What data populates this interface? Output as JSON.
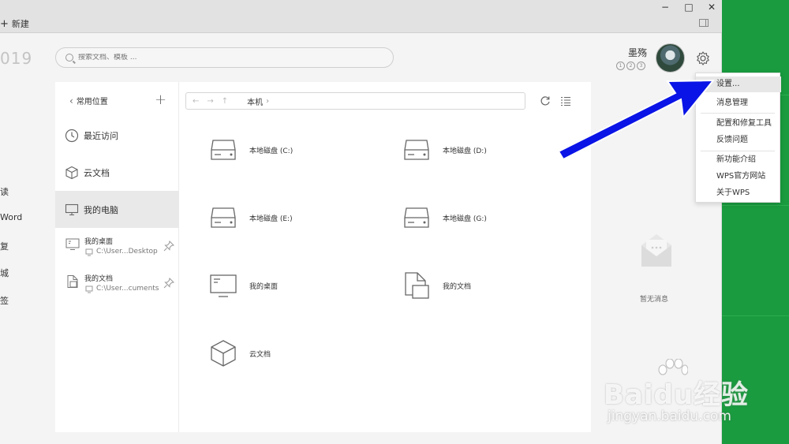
{
  "titlebar": {
    "new_label": "新建",
    "minimize": "−",
    "maximize": "□",
    "close": "✕"
  },
  "left_fragments": {
    "year": "019",
    "items": [
      "读",
      "Word",
      "复",
      "城",
      "签"
    ]
  },
  "search": {
    "placeholder": "搜索文档、模板 ..."
  },
  "user": {
    "name": "墨殇",
    "badges": [
      "1",
      "2",
      "3"
    ]
  },
  "sidebar": {
    "header": "常用位置",
    "items": [
      {
        "label": "最近访问",
        "icon": "clock-icon"
      },
      {
        "label": "云文档",
        "icon": "cube-icon"
      },
      {
        "label": "我的电脑",
        "icon": "monitor-icon"
      }
    ],
    "pinned": [
      {
        "title": "我的桌面",
        "path": "C:\\User...Desktop"
      },
      {
        "title": "我的文档",
        "path": "C:\\User...cuments"
      }
    ]
  },
  "pathbar": {
    "crumb": "本机"
  },
  "drives": [
    {
      "label": "本地磁盘 (C:)",
      "icon": "disk-icon"
    },
    {
      "label": "本地磁盘 (D:)",
      "icon": "disk-icon"
    },
    {
      "label": "本地磁盘 (E:)",
      "icon": "disk-icon"
    },
    {
      "label": "本地磁盘 (G:)",
      "icon": "disk-icon"
    },
    {
      "label": "我的桌面",
      "icon": "desktop-icon"
    },
    {
      "label": "我的文档",
      "icon": "document-icon"
    },
    {
      "label": "云文档",
      "icon": "cube-icon"
    }
  ],
  "messages": {
    "empty": "暂无消息"
  },
  "menu": {
    "items": [
      "设置...",
      "消息管理",
      "配置和修复工具",
      "反馈问题",
      "新功能介绍",
      "WPS官方网站",
      "关于WPS"
    ]
  },
  "watermark": {
    "logo": "Baidu经验",
    "url": "jingyan.baidu.com"
  },
  "colors": {
    "green": "#1a9b3f",
    "arrow": "#0a14e6"
  }
}
